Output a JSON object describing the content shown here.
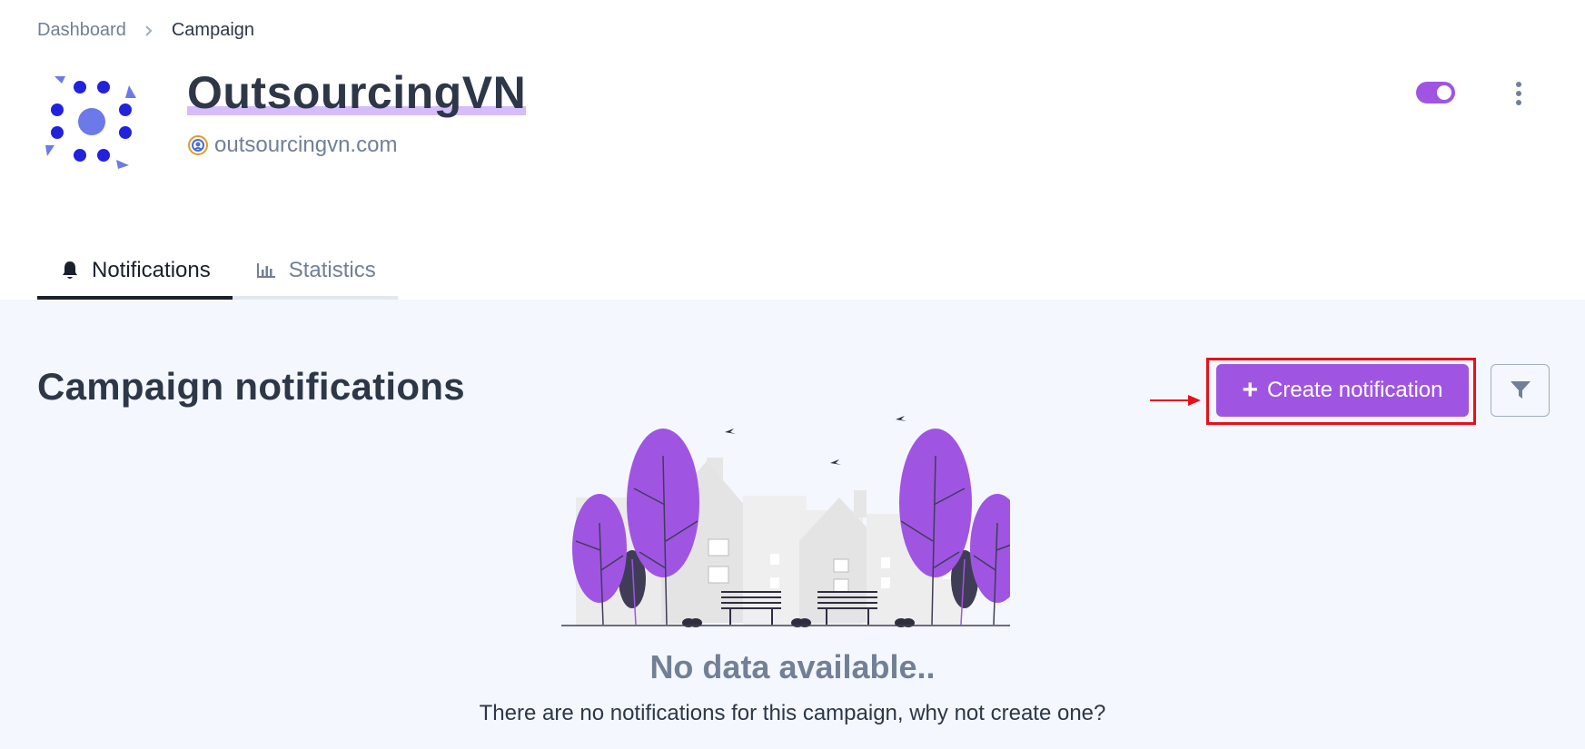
{
  "breadcrumb": {
    "parent": "Dashboard",
    "current": "Campaign"
  },
  "campaign": {
    "name": "OutsourcingVN",
    "domain": "outsourcingvn.com",
    "active": true
  },
  "icons": {
    "logo": "campaign-logo-icon",
    "domain": "globe-icon",
    "kebab": "more-vertical-icon",
    "notifications_tab": "bell-icon",
    "statistics_tab": "bar-chart-icon",
    "filter": "filter-icon",
    "create": "plus-icon",
    "chevron": "chevron-right-icon"
  },
  "tabs": [
    {
      "label": "Notifications",
      "active": true
    },
    {
      "label": "Statistics",
      "active": false
    }
  ],
  "section": {
    "title": "Campaign notifications"
  },
  "actions": {
    "create_label": "Create notification"
  },
  "empty_state": {
    "title": "No data available..",
    "subtitle": "There are no notifications for this campaign, why not create one?"
  },
  "colors": {
    "accent": "#9f55e2",
    "annotation": "#e8101a",
    "main_bg": "#f4f7fd",
    "title_highlight": "#d6bcfa"
  }
}
